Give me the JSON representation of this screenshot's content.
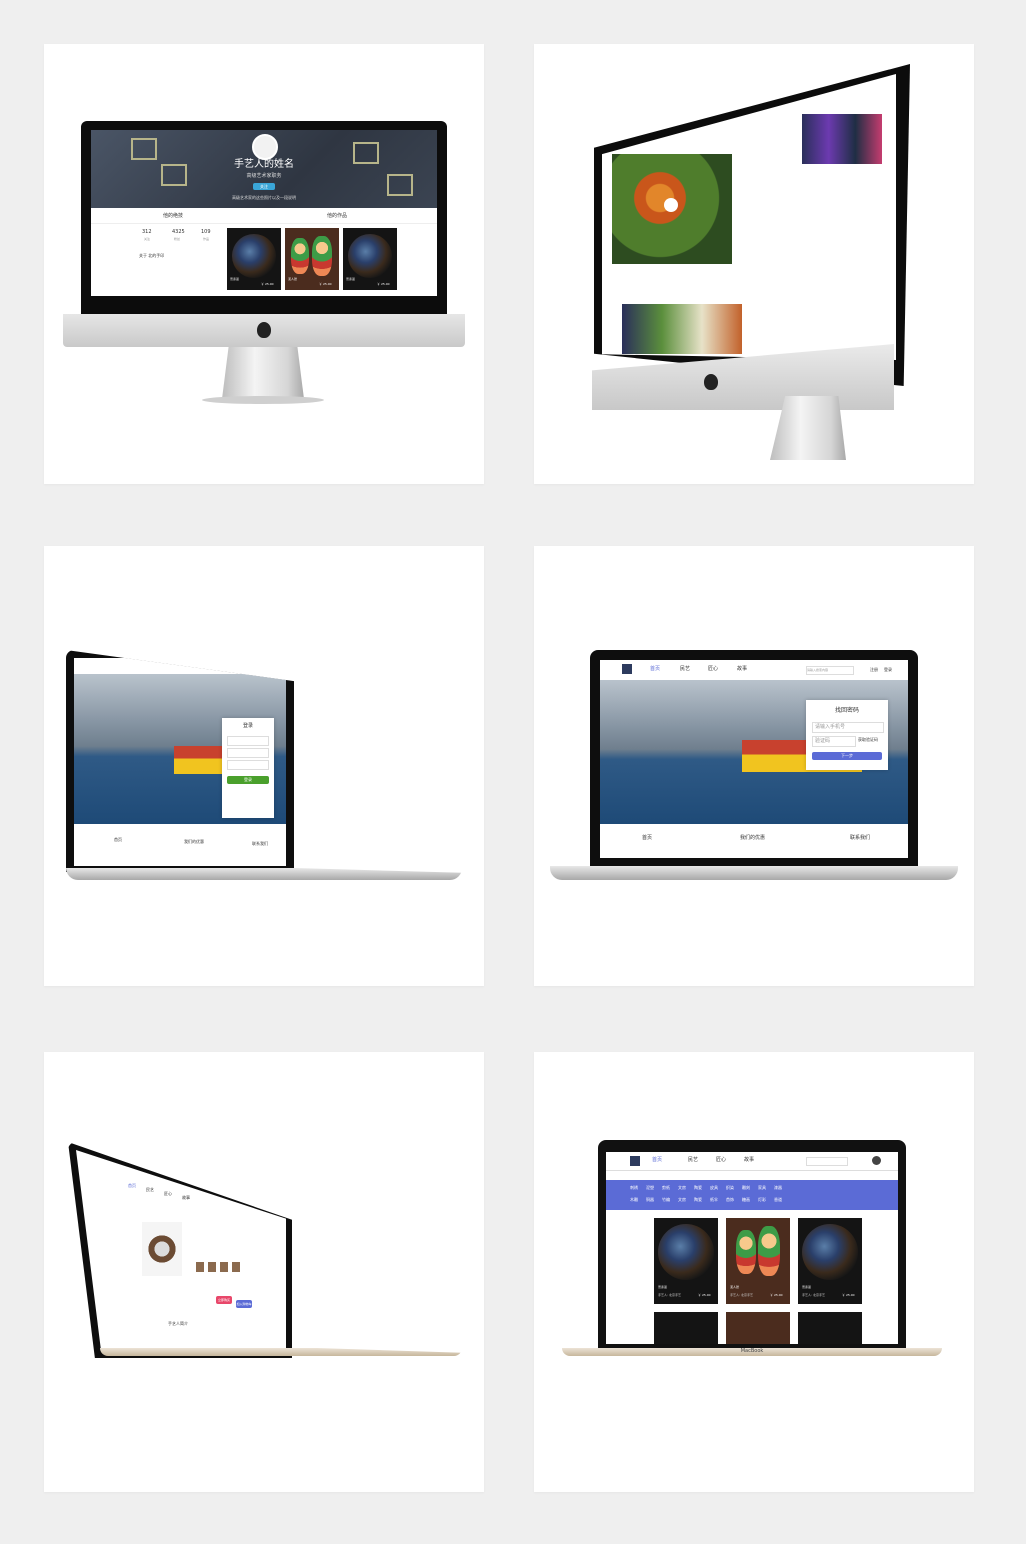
{
  "profile": {
    "name": "手艺人的姓名",
    "subtitle": "高级艺术家职务",
    "follow_label": "关注",
    "bio": "高级艺术家的这些照片以及一段说明",
    "tab_craft": "他的绝技",
    "tab_works": "他的作品",
    "stats": [
      {
        "value": "312",
        "label": "关注"
      },
      {
        "value": "4325",
        "label": "粉丝"
      },
      {
        "value": "109",
        "label": "作品"
      }
    ],
    "about_label": "关于 北的手印",
    "works": [
      {
        "title": "景泰蓝",
        "sub": "手艺人: 北京手艺",
        "price": "￥ 25.00"
      },
      {
        "title": "泥人张",
        "sub": "手艺人: 北京手艺",
        "price": "￥ 25.00"
      },
      {
        "title": "景泰蓝",
        "sub": "手艺人: 北京手艺",
        "price": "￥ 25.00"
      }
    ]
  },
  "login": {
    "title": "登录",
    "button": "登录",
    "bottom": [
      "首页",
      "我们的优惠",
      "联系我们"
    ]
  },
  "recover": {
    "title": "找回密码",
    "phone_placeholder": "请输入手机号",
    "code_placeholder": "验证码",
    "send_label": "获取验证码",
    "next_label": "下一步",
    "search_placeholder": "请输入搜索内容",
    "register": "注册",
    "login": "登录",
    "nav": [
      "首页",
      "民艺",
      "匠心",
      "故事"
    ],
    "footer": [
      "首页",
      "我们的优惠",
      "联系我们"
    ]
  },
  "grid_page": {
    "nav": [
      "首页",
      "民艺",
      "匠心",
      "故事"
    ],
    "tags_row1": [
      "刺绣",
      "泥塑",
      "剪纸",
      "文房",
      "陶瓷",
      "皮具",
      "织染",
      "雕刻",
      "家具",
      "漆器"
    ],
    "tags_row2": [
      "木雕",
      "铜器",
      "竹编",
      "文房",
      "陶瓷",
      "纸伞",
      "首饰",
      "糖画",
      "灯彩",
      "香道"
    ],
    "items": [
      {
        "title": "景泰蓝",
        "sub": "手艺人: 北京手艺",
        "price": "￥ 25.00"
      },
      {
        "title": "泥人张",
        "sub": "手艺人: 北京手艺",
        "price": "￥ 25.00"
      },
      {
        "title": "景泰蓝",
        "sub": "手艺人: 北京手艺",
        "price": "￥ 25.00"
      }
    ],
    "laptop_label": "MacBook"
  },
  "product_page": {
    "nav": [
      "首页",
      "民艺",
      "匠心",
      "故事"
    ],
    "buy_label": "立即购买",
    "cart_label": "加入购物车",
    "section_label": "手艺人简介"
  }
}
